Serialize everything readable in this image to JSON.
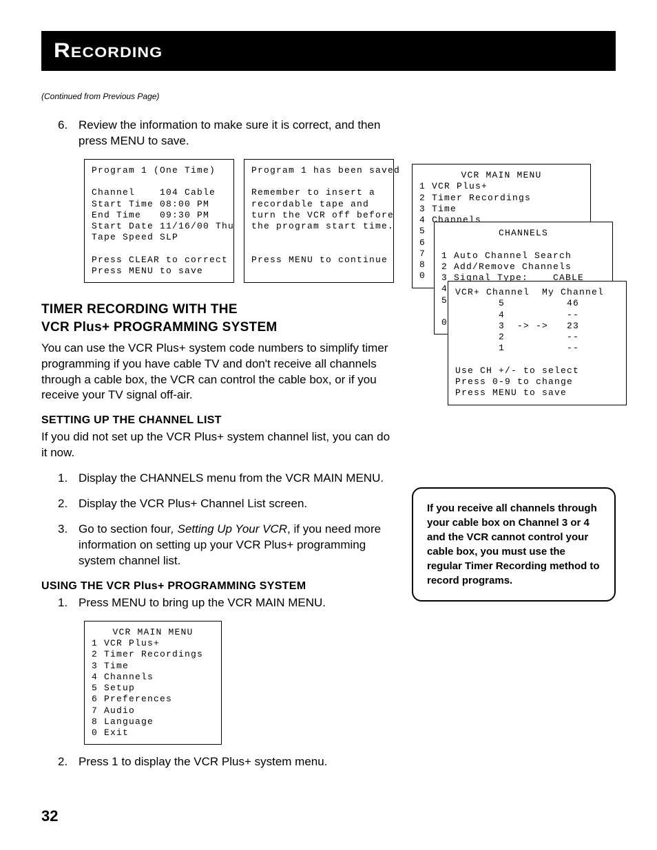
{
  "header": {
    "title": "Recording"
  },
  "cont_note": "(Continued from Previous Page)",
  "step6": {
    "num": "6.",
    "text": "Review the information to make sure it is correct, and then press MENU to save."
  },
  "osd_program_review": "Program 1 (One Time)\n\nChannel    104 Cable\nStart Time 08:00 PM\nEnd Time   09:30 PM\nStart Date 11/16/00 Thu\nTape Speed SLP\n\nPress CLEAR to correct\nPress MENU to save",
  "osd_program_saved": "Program 1 has been saved\n\nRemember to insert a\nrecordable tape and\nturn the VCR off before\nthe program start time.\n\n\nPress MENU to continue",
  "sec_timer": {
    "line1": "TIMER RECORDING WITH THE",
    "line2_a": "VCR P",
    "line2_b": "lus",
    "line2_c": "+ PROGRAMMING SYSTEM",
    "intro": "You can use the VCR Plus+ system code numbers to simplify timer programming if you have cable TV and don't receive all channels through a cable box, the VCR can control the cable box, or if you receive your TV signal off-air."
  },
  "sec_setup": {
    "title": "SETTING UP THE CHANNEL LIST",
    "intro": "If you did not set up the VCR Plus+ system channel list, you can do it now.",
    "steps": [
      {
        "num": "1.",
        "text": "Display the CHANNELS menu from the VCR MAIN MENU."
      },
      {
        "num": "2.",
        "text": "Display the VCR Plus+ Channel List screen."
      },
      {
        "num": "3.",
        "pre": "Go to section four",
        "ital": ", Setting Up Your VCR",
        "post": ", if you need more information on setting up your VCR Plus+ programming system channel list."
      }
    ]
  },
  "sec_using": {
    "title_a": "USING THE VCR P",
    "title_b": "lus",
    "title_c": "+ PROGRAMMING SYSTEM",
    "steps": [
      {
        "num": "1.",
        "text": "Press MENU to bring up the VCR MAIN MENU."
      },
      {
        "num": "2.",
        "text": "Press 1 to display  the VCR Plus+ system menu."
      }
    ]
  },
  "osd_main_menu_title": "VCR MAIN MENU",
  "osd_main_menu_body": "1 VCR Plus+\n2 Timer Recordings\n3 Time\n4 Channels\n5 Setup\n6 Preferences\n7 Audio\n8 Language\n0 Exit",
  "osd_layer1_title": "VCR MAIN MENU",
  "osd_layer1_body": "1 VCR Plus+\n2 Timer Recordings\n3 Time\n4 Channels\n5\n6\n7\n8\n0",
  "osd_layer2_title": "CHANNELS",
  "osd_layer2_body": "1 Auto Channel Search\n2 Add/Remove Channels\n3 Signal Type:    CABLE\n4 VCR Plus+ Setup\n5\n\n0",
  "osd_layer3_head": "VCR+ Channel  My Channel",
  "osd_layer3_body": "       5          46\n       4          --\n       3  -> ->   23\n       2          --\n       1          --\n\nUse CH +/- to select\nPress 0-9 to change\nPress MENU to save",
  "note_box": "If you receive all channels through your cable box on Channel 3 or 4 and the VCR cannot control your cable box, you must use the regular Timer Recording method to record programs.",
  "page_number": "32"
}
